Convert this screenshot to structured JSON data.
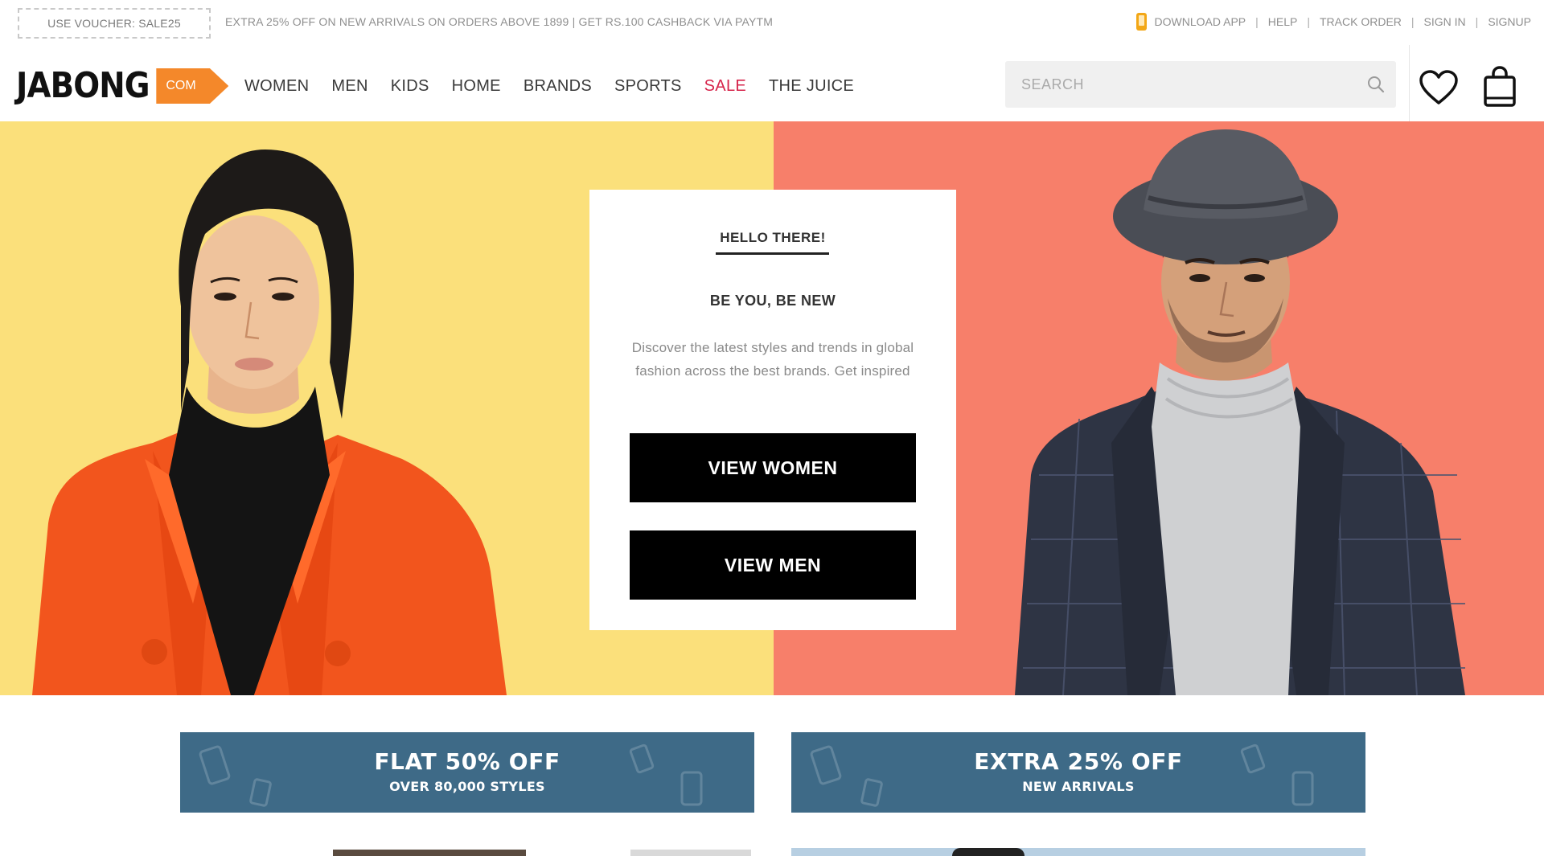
{
  "topbar": {
    "voucher": "USE VOUCHER: SALE25",
    "promo": "EXTRA 25% OFF ON NEW ARRIVALS ON ORDERS ABOVE 1899 | GET RS.100 CASHBACK VIA PAYTM",
    "links": {
      "download_app": "DOWNLOAD APP",
      "help": "HELP",
      "track_order": "TRACK ORDER",
      "sign_in": "SIGN IN",
      "signup": "SIGNUP"
    },
    "separator": "|"
  },
  "header": {
    "logo": {
      "text": "JABONG",
      "tag": "COM"
    },
    "nav": {
      "women": "WOMEN",
      "men": "MEN",
      "kids": "KIDS",
      "home": "HOME",
      "brands": "BRANDS",
      "sports": "SPORTS",
      "sale": "SALE",
      "the_juice": "THE JUICE"
    },
    "search": {
      "placeholder": "SEARCH",
      "value": ""
    }
  },
  "hero": {
    "hello": "HELLO THERE!",
    "tagline": "BE YOU, BE NEW",
    "description": "Discover the latest styles and trends in global fashion across the best brands. Get inspired",
    "view_women": "VIEW WOMEN",
    "view_men": "VIEW MEN"
  },
  "offers": [
    {
      "title": "FLAT 50% OFF",
      "subtitle": "OVER 80,000 STYLES"
    },
    {
      "title": "EXTRA 25% OFF",
      "subtitle": "NEW ARRIVALS"
    }
  ],
  "colors": {
    "brand_orange": "#f4882a",
    "sale_red": "#d6244b",
    "hero_left_bg": "#fbe07b",
    "hero_right_bg": "#f77f6a",
    "offer_bg": "#3e6a87"
  },
  "icons": {
    "phone": "phone-icon",
    "search": "search-icon",
    "wishlist": "heart-icon",
    "bag": "shopping-bag-icon"
  }
}
